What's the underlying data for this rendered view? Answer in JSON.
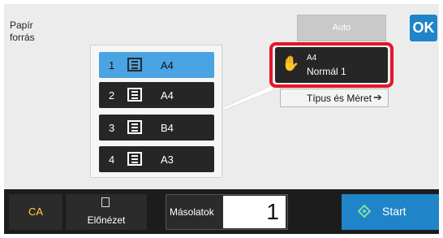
{
  "panel": {
    "title_line1": "Papír",
    "title_line2": "forrás"
  },
  "auto_button": "Auto",
  "ok_button": "OK",
  "trays": [
    {
      "number": "1",
      "paper": "A4",
      "selected": true
    },
    {
      "number": "2",
      "paper": "A4",
      "selected": false
    },
    {
      "number": "3",
      "paper": "B4",
      "selected": false
    },
    {
      "number": "4",
      "paper": "A3",
      "selected": false
    }
  ],
  "bypass": {
    "size": "A4",
    "type": "Normál 1"
  },
  "type_size_button": "Típus és Méret",
  "bottom": {
    "ca": "CA",
    "preview": "Előnézet",
    "copies_label": "Másolatok",
    "copies_value": "1",
    "start": "Start"
  },
  "colors": {
    "accent": "#1f84c8",
    "selected_tray": "#4aa3e2",
    "highlight": "#e5142b",
    "ca_text": "#ffd33a"
  }
}
